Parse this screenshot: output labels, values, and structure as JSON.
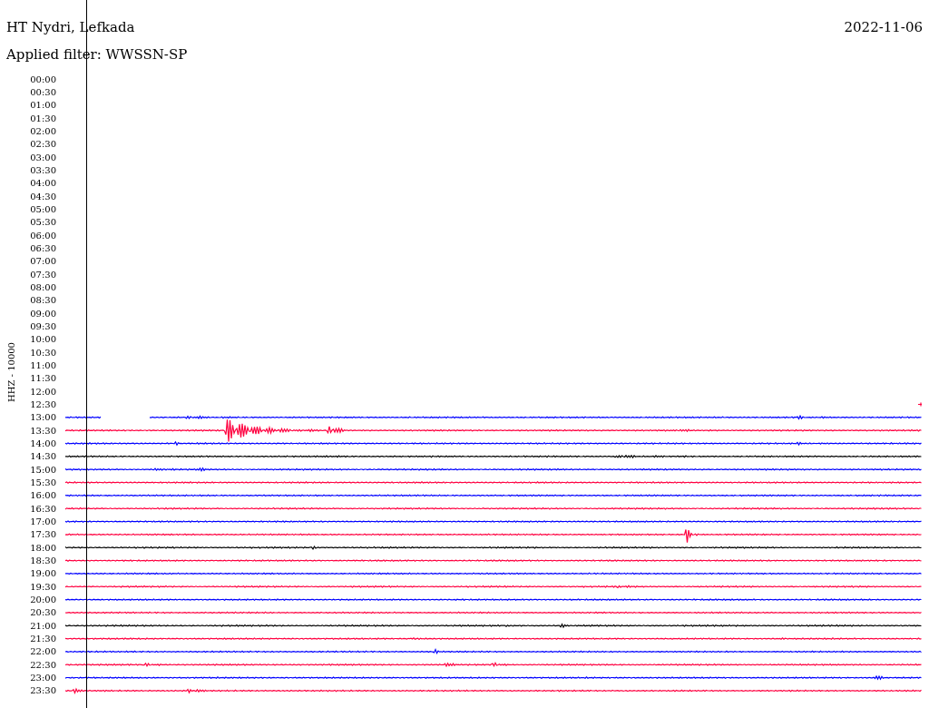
{
  "header": {
    "title": "HT Nydri, Lefkada",
    "date": "2022-11-06",
    "filter": "Applied filter: WWSSN-SP"
  },
  "axis_label": "HHZ - 10000",
  "rows": [
    {
      "time": "00:00",
      "kind": "empty"
    },
    {
      "time": "00:30",
      "kind": "empty"
    },
    {
      "time": "01:00",
      "kind": "empty"
    },
    {
      "time": "01:30",
      "kind": "empty"
    },
    {
      "time": "02:00",
      "kind": "empty"
    },
    {
      "time": "02:30",
      "kind": "empty"
    },
    {
      "time": "03:00",
      "kind": "empty"
    },
    {
      "time": "03:30",
      "kind": "empty"
    },
    {
      "time": "04:00",
      "kind": "empty"
    },
    {
      "time": "04:30",
      "kind": "empty"
    },
    {
      "time": "05:00",
      "kind": "empty"
    },
    {
      "time": "05:30",
      "kind": "empty"
    },
    {
      "time": "06:00",
      "kind": "empty"
    },
    {
      "time": "06:30",
      "kind": "empty"
    },
    {
      "time": "07:00",
      "kind": "empty"
    },
    {
      "time": "07:30",
      "kind": "empty"
    },
    {
      "time": "08:00",
      "kind": "empty"
    },
    {
      "time": "08:30",
      "kind": "empty"
    },
    {
      "time": "09:00",
      "kind": "empty"
    },
    {
      "time": "09:30",
      "kind": "empty"
    },
    {
      "time": "10:00",
      "kind": "empty"
    },
    {
      "time": "10:30",
      "kind": "empty"
    },
    {
      "time": "11:00",
      "kind": "empty"
    },
    {
      "time": "11:30",
      "kind": "empty"
    },
    {
      "time": "12:00",
      "kind": "empty"
    },
    {
      "time": "12:30",
      "kind": "tail",
      "color": "#ff0040"
    },
    {
      "time": "13:00",
      "kind": "partial",
      "color": "#0000ff"
    },
    {
      "time": "13:30",
      "kind": "trace",
      "color": "#ff0040"
    },
    {
      "time": "14:00",
      "kind": "trace",
      "color": "#0000ff"
    },
    {
      "time": "14:30",
      "kind": "trace",
      "color": "#000000"
    },
    {
      "time": "15:00",
      "kind": "trace",
      "color": "#0000ff"
    },
    {
      "time": "15:30",
      "kind": "trace",
      "color": "#ff0040"
    },
    {
      "time": "16:00",
      "kind": "trace",
      "color": "#0000ff"
    },
    {
      "time": "16:30",
      "kind": "trace",
      "color": "#ff0040"
    },
    {
      "time": "17:00",
      "kind": "trace",
      "color": "#0000ff"
    },
    {
      "time": "17:30",
      "kind": "trace",
      "color": "#ff0040"
    },
    {
      "time": "18:00",
      "kind": "trace",
      "color": "#000000"
    },
    {
      "time": "18:30",
      "kind": "trace",
      "color": "#ff0040"
    },
    {
      "time": "19:00",
      "kind": "trace",
      "color": "#0000ff"
    },
    {
      "time": "19:30",
      "kind": "trace",
      "color": "#ff0040"
    },
    {
      "time": "20:00",
      "kind": "trace",
      "color": "#0000ff"
    },
    {
      "time": "20:30",
      "kind": "trace",
      "color": "#ff0040"
    },
    {
      "time": "21:00",
      "kind": "trace",
      "color": "#000000"
    },
    {
      "time": "21:30",
      "kind": "trace",
      "color": "#ff0040"
    },
    {
      "time": "22:00",
      "kind": "trace",
      "color": "#0000ff"
    },
    {
      "time": "22:30",
      "kind": "trace",
      "color": "#ff0040"
    },
    {
      "time": "23:00",
      "kind": "trace",
      "color": "#0000ff"
    },
    {
      "time": "23:30",
      "kind": "trace",
      "color": "#ff0040"
    }
  ]
}
